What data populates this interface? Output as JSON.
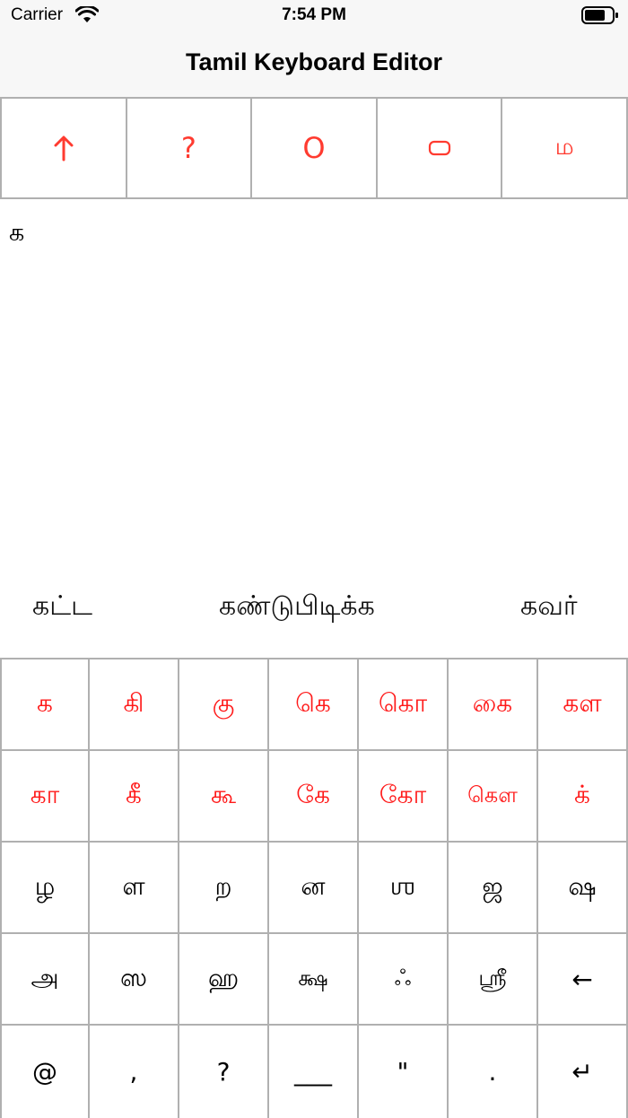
{
  "status": {
    "carrier": "Carrier",
    "time": "7:54 PM"
  },
  "nav": {
    "title": "Tamil Keyboard Editor"
  },
  "toolbar": [
    {
      "name": "shift-arrow-icon",
      "label": "↑"
    },
    {
      "name": "help-button",
      "label": "?"
    },
    {
      "name": "circle-button",
      "label": "O"
    },
    {
      "name": "rounded-rect-icon",
      "label": ""
    },
    {
      "name": "tamil-ma-button",
      "label": "ம"
    }
  ],
  "editor": {
    "text": "க"
  },
  "suggestions": [
    "கட்ட",
    "கண்டுபிடிக்க",
    "கவர்"
  ],
  "keyboard": {
    "row1": [
      "க",
      "கி",
      "கு",
      "கெ",
      "கொ",
      "கை",
      "கள"
    ],
    "row2": [
      "கா",
      "கீ",
      "கூ",
      "கே",
      "கோ",
      "கௌ",
      "க்"
    ],
    "row3": [
      "ழ",
      "ள",
      "ற",
      "ன",
      "ஶ",
      "ஜ",
      "ஷ"
    ],
    "row4": [
      "அ",
      "ஸ",
      "ஹ",
      "க்ஷ",
      "ஃ",
      "ஸ்ரீ",
      "←"
    ],
    "row5": [
      "@",
      ",",
      "?",
      "___",
      "\"",
      ".",
      "↵"
    ]
  },
  "colors": {
    "accent": "#ff3b30",
    "consonant_red": "#ff1a1a",
    "grid": "#b0b0b0"
  }
}
